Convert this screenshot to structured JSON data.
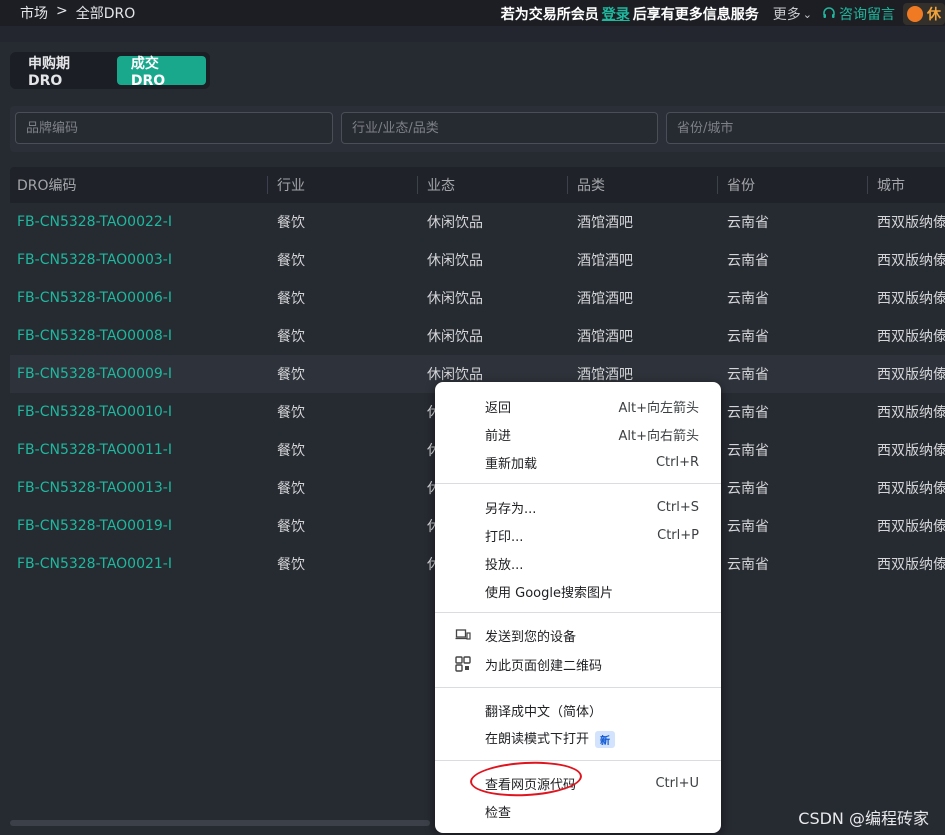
{
  "breadcrumb": {
    "root": "市场",
    "separator": ">",
    "current": "全部DRO"
  },
  "topbar": {
    "notice_prefix": "若为交易所会员",
    "login": "登录",
    "notice_suffix": "后享有更多信息服务",
    "more": "更多",
    "consult": "咨询留言",
    "rest": "休"
  },
  "tabs": [
    {
      "label": "申购期DRO",
      "active": false
    },
    {
      "label": "成交DRO",
      "active": true
    }
  ],
  "filters": {
    "brand_placeholder": "品牌编码",
    "industry_placeholder": "行业/业态/品类",
    "region_placeholder": "省份/城市"
  },
  "table": {
    "headers": [
      "DRO编码",
      "行业",
      "业态",
      "品类",
      "省份",
      "城市"
    ],
    "rows": [
      [
        "FB-CN5328-TAO0022-I",
        "餐饮",
        "休闲饮品",
        "酒馆酒吧",
        "云南省",
        "西双版纳傣"
      ],
      [
        "FB-CN5328-TAO0003-I",
        "餐饮",
        "休闲饮品",
        "酒馆酒吧",
        "云南省",
        "西双版纳傣"
      ],
      [
        "FB-CN5328-TAO0006-I",
        "餐饮",
        "休闲饮品",
        "酒馆酒吧",
        "云南省",
        "西双版纳傣"
      ],
      [
        "FB-CN5328-TAO0008-I",
        "餐饮",
        "休闲饮品",
        "酒馆酒吧",
        "云南省",
        "西双版纳傣"
      ],
      [
        "FB-CN5328-TAO0009-I",
        "餐饮",
        "休闲饮品",
        "酒馆酒吧",
        "云南省",
        "西双版纳傣"
      ],
      [
        "FB-CN5328-TAO0010-I",
        "餐饮",
        "休",
        "",
        "云南省",
        "西双版纳傣"
      ],
      [
        "FB-CN5328-TAO0011-I",
        "餐饮",
        "休",
        "",
        "云南省",
        "西双版纳傣"
      ],
      [
        "FB-CN5328-TAO0013-I",
        "餐饮",
        "休",
        "",
        "云南省",
        "西双版纳傣"
      ],
      [
        "FB-CN5328-TAO0019-I",
        "餐饮",
        "休",
        "",
        "云南省",
        "西双版纳傣"
      ],
      [
        "FB-CN5328-TAO0021-I",
        "餐饮",
        "休",
        "",
        "云南省",
        "西双版纳傣"
      ]
    ]
  },
  "context_menu": {
    "back": {
      "label": "返回",
      "shortcut": "Alt+向左箭头"
    },
    "forward": {
      "label": "前进",
      "shortcut": "Alt+向右箭头"
    },
    "reload": {
      "label": "重新加载",
      "shortcut": "Ctrl+R"
    },
    "save_as": {
      "label": "另存为...",
      "shortcut": "Ctrl+S"
    },
    "print": {
      "label": "打印...",
      "shortcut": "Ctrl+P"
    },
    "cast": {
      "label": "投放..."
    },
    "google_lens": {
      "label": "使用 Google搜索图片"
    },
    "send_device": {
      "label": "发送到您的设备"
    },
    "qr_code": {
      "label": "为此页面创建二维码"
    },
    "translate": {
      "label": "翻译成中文（简体）"
    },
    "reader_mode": {
      "label": "在朗读模式下打开",
      "badge": "新"
    },
    "view_source": {
      "label": "查看网页源代码",
      "shortcut": "Ctrl+U"
    },
    "inspect": {
      "label": "检查"
    }
  },
  "watermark": "CSDN @编程砖家",
  "colors": {
    "accent": "#1fb89e",
    "tab_active": "#1aa88d",
    "background": "#23262e",
    "annotation": "#e0141e"
  }
}
